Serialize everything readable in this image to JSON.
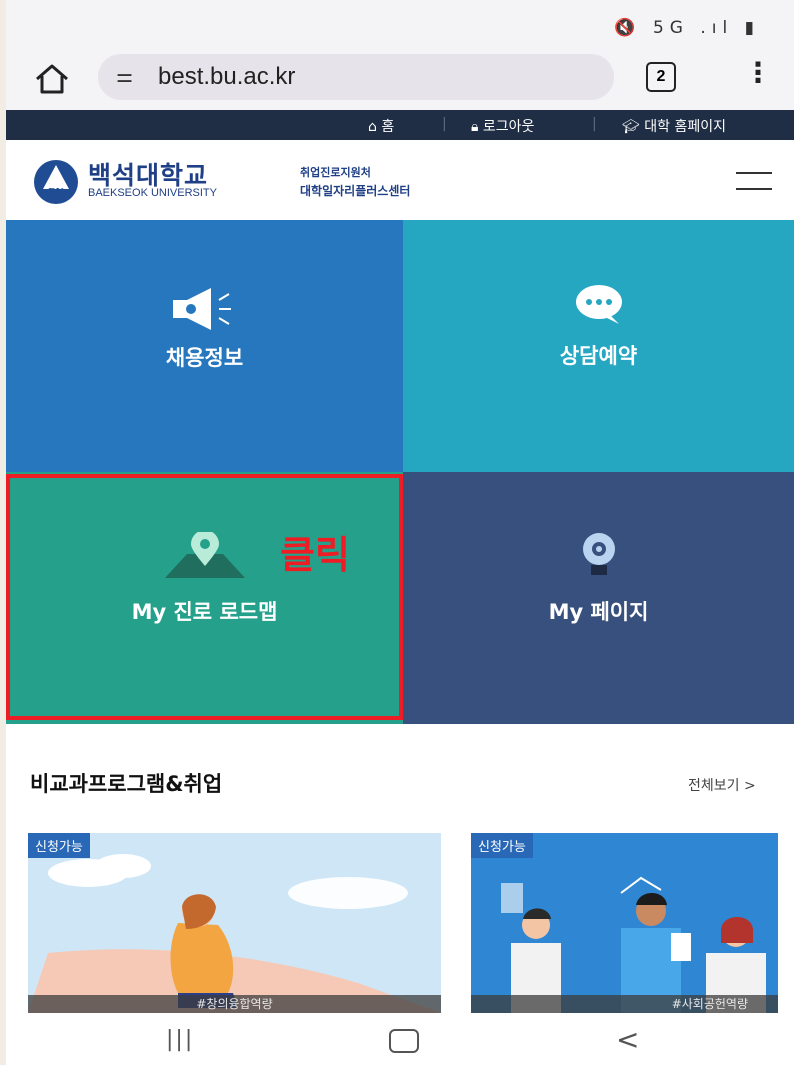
{
  "status_bar": {
    "icons": "🔇 5G .ıl ▮"
  },
  "browser": {
    "url": "best.bu.ac.kr",
    "tab_count": "2",
    "site_info_icon": "⚌"
  },
  "top_nav": {
    "home": "홈",
    "logout": "로그아웃",
    "univ_home": "대학 홈페이지"
  },
  "header": {
    "logo_ko": "백석대학교",
    "logo_en": "BAEKSEOK UNIVERSITY",
    "emblem_text": "BU",
    "center_line1": "취업진로지원처",
    "center_line2": "대학일자리플러스센터"
  },
  "tiles": {
    "jobs": "채용정보",
    "consult": "상담예약",
    "roadmap": "My 진로 로드맵",
    "mypage": "My 페이지"
  },
  "annotation": {
    "click": "클릭"
  },
  "section": {
    "title": "비교과프로그램&취업",
    "view_all": "전체보기 >",
    "cards": [
      {
        "badge": "신청가능",
        "caption": "#창의융합역량"
      },
      {
        "badge": "신청가능",
        "caption": "#사회공헌역량"
      }
    ]
  },
  "colors": {
    "jobs_tile": "#2677bd",
    "consult_tile": "#25a6c1",
    "roadmap_tile": "#25a08a",
    "mypage_tile": "#37507d",
    "highlight": "#ee1c24",
    "nav_dark": "#1f2d45"
  }
}
